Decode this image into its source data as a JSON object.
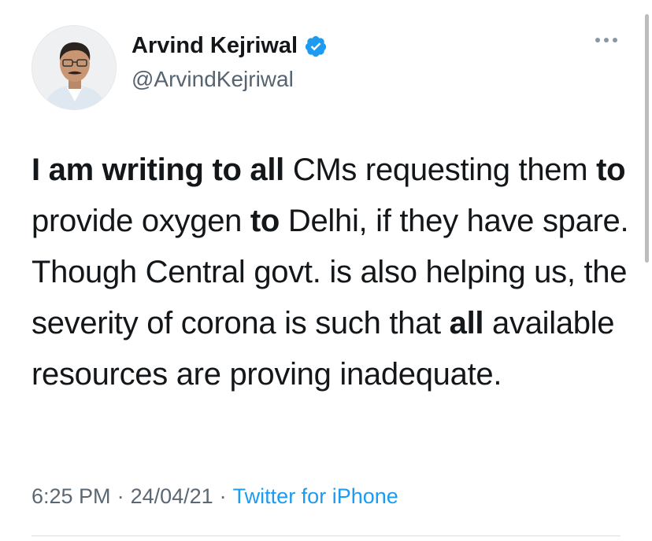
{
  "user": {
    "display_name": "Arvind Kejriwal",
    "handle": "@ArvindKejriwal",
    "verified": true,
    "verified_icon": "verified-badge-icon"
  },
  "tweet": {
    "segments": [
      {
        "text": "I am writing to all",
        "bold": true
      },
      {
        "text": " CMs requesting them ",
        "bold": false
      },
      {
        "text": "to",
        "bold": true
      },
      {
        "text": " provide oxygen ",
        "bold": false
      },
      {
        "text": "to",
        "bold": true
      },
      {
        "text": " Delhi, if they have spare. Though Central govt. is also helping us, the severity of corona is such that ",
        "bold": false
      },
      {
        "text": "all",
        "bold": true
      },
      {
        "text": " available resources are proving inadequate.",
        "bold": false
      }
    ]
  },
  "meta": {
    "time": "6:25 PM",
    "separator": "·",
    "date": "24/04/21",
    "source": "Twitter for iPhone"
  },
  "colors": {
    "accent": "#1d9bf0",
    "text": "#14171a",
    "muted": "#566370"
  }
}
